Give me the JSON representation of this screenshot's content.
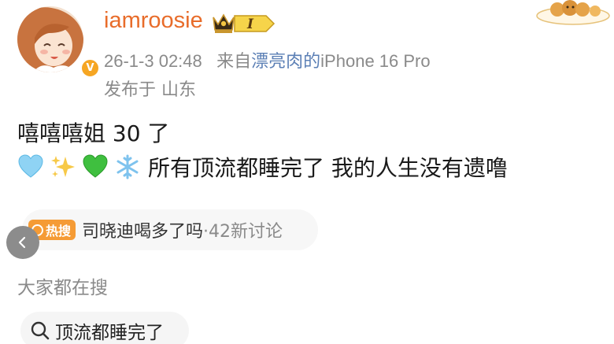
{
  "post": {
    "username": "iamroosie",
    "vip_level": "I",
    "timestamp": "26-1-3 02:48",
    "source_prefix": "来自",
    "source_name": "漂亮肉的",
    "source_device": "iPhone 16 Pro",
    "location": "发布于 山东",
    "text_line1": "嘻嘻嘻姐 30 了",
    "text_line2": "所有顶流都睡完了 我的人生没有遗噜",
    "emojis": [
      "light-blue-heart",
      "sparkles",
      "green-heart",
      "snowflake"
    ]
  },
  "hot_search": {
    "tag": "热搜",
    "topic": "司晓迪喝多了吗",
    "count": "·42新讨论"
  },
  "search_section": {
    "label": "大家都在搜",
    "chip": "顶流都睡完了"
  },
  "colors": {
    "username": "#e86c2a",
    "source_link": "#5b7fb5",
    "hot_tag": "#f59b35",
    "meta_gray": "#8a8a8a",
    "verified_badge": "#f6a623"
  },
  "icons": {
    "back": "chevron-left-icon",
    "search": "search-icon",
    "verified": "verified-v-icon",
    "crown": "crown-icon"
  }
}
